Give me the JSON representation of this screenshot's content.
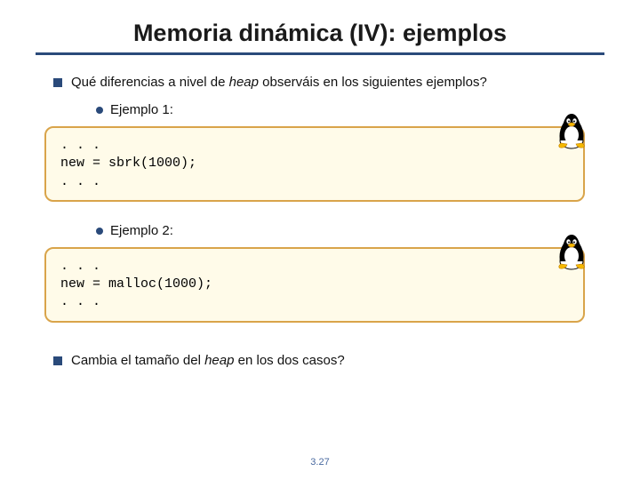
{
  "title": "Memoria dinámica (IV): ejemplos",
  "bullet1_pre": "Qué diferencias a nivel de ",
  "bullet1_em": "heap",
  "bullet1_post": " observáis en los siguientes ejemplos?",
  "sub1": "Ejemplo 1:",
  "code1": ". . .\nnew = sbrk(1000);\n. . .",
  "sub2": "Ejemplo 2:",
  "code2": ". . .\nnew = malloc(1000);\n. . .",
  "bullet2_pre": "Cambia el tamaño del ",
  "bullet2_em": "heap",
  "bullet2_post": " en los dos casos?",
  "page_number": "3.27",
  "icons": {
    "tux": "tux-penguin-icon"
  }
}
